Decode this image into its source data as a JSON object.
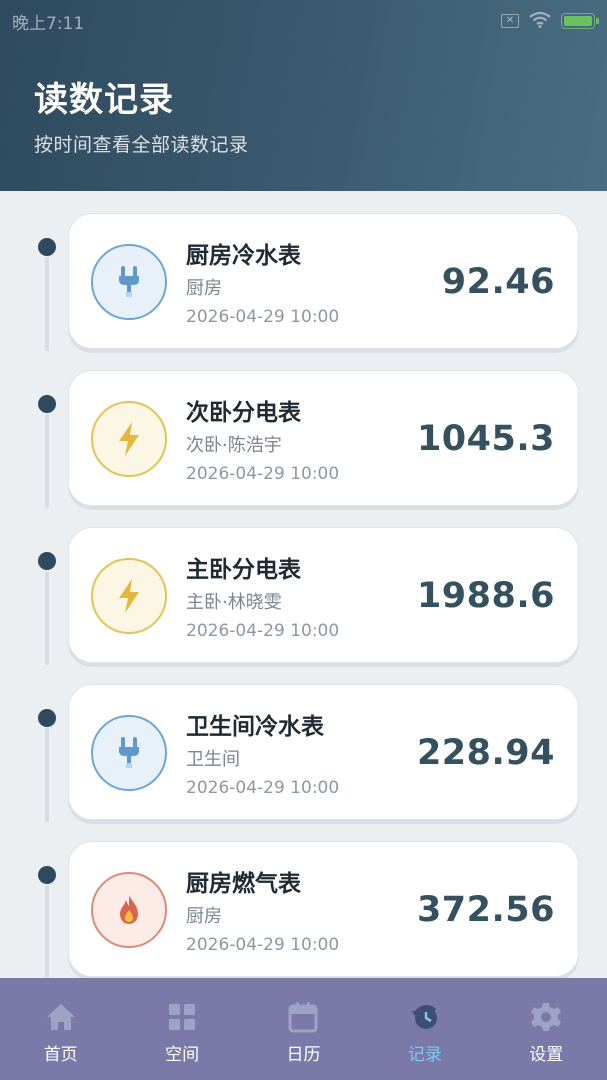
{
  "status_bar": {
    "time": "晚上7:11"
  },
  "header": {
    "title": "读数记录",
    "subtitle": "按时间查看全部读数记录"
  },
  "records": [
    {
      "name": "厨房冷水表",
      "location": "厨房",
      "time": "2026-04-29 10:00",
      "value": "92.46",
      "type": "water",
      "icon": "faucet-icon"
    },
    {
      "name": "次卧分电表",
      "location": "次卧·陈浩宇",
      "time": "2026-04-29 10:00",
      "value": "1045.3",
      "type": "electric",
      "icon": "lightning-icon"
    },
    {
      "name": "主卧分电表",
      "location": "主卧·林晓雯",
      "time": "2026-04-29 10:00",
      "value": "1988.6",
      "type": "electric",
      "icon": "lightning-icon"
    },
    {
      "name": "卫生间冷水表",
      "location": "卫生间",
      "time": "2026-04-29 10:00",
      "value": "228.94",
      "type": "water",
      "icon": "faucet-icon"
    },
    {
      "name": "厨房燃气表",
      "location": "厨房",
      "time": "2026-04-29 10:00",
      "value": "372.56",
      "type": "gas",
      "icon": "flame-icon"
    }
  ],
  "bottom_nav": {
    "items": [
      {
        "label": "首页",
        "icon": "home-icon"
      },
      {
        "label": "空间",
        "icon": "grid-icon"
      },
      {
        "label": "日历",
        "icon": "calendar-icon"
      },
      {
        "label": "记录",
        "icon": "record-icon",
        "active": true
      },
      {
        "label": "设置",
        "icon": "gear-icon"
      }
    ]
  },
  "colors": {
    "header_bg": "#2f4a5e",
    "nav_bg": "#7a79a7",
    "nav_active": "#7fc8f0",
    "water": "#6ea5d4",
    "electric": "#e6c253",
    "gas": "#dc8a7c",
    "value_text": "#35505f"
  }
}
